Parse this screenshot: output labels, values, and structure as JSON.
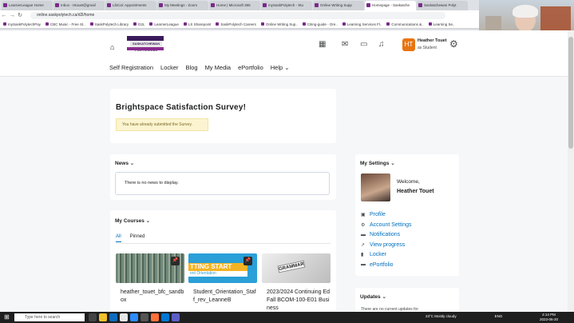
{
  "browser": {
    "tabs": [
      {
        "label": "LearnerLeague Home",
        "active": false
      },
      {
        "label": "Inbox - Htouet@gmail",
        "active": false
      },
      {
        "label": "LibCal: Appointments",
        "active": false
      },
      {
        "label": "My Meetings - Zoom",
        "active": false
      },
      {
        "label": "Home | Microsoft 365",
        "active": false
      },
      {
        "label": "mySaskPolytech - Stu",
        "active": false
      },
      {
        "label": "Online Writing Supp",
        "active": false
      },
      {
        "label": "Homepage - Saskatche",
        "active": true
      },
      {
        "label": "Saskatchewan Polyt",
        "active": false
      }
    ],
    "url": "online.saskpolytech.ca/d2l/home",
    "bookmarks": [
      "mySaskPolytechPay",
      "CBC Music - Free St..",
      "SaskPolytech Library",
      "D2L",
      "LearnerLeague",
      "LS Sharepoint",
      "SaskPolytech Careers",
      "Online Writing Sup..",
      "Citing-guide - Ore..",
      "Learning Services Fl..",
      "Communications &..",
      "Learning Se.."
    ]
  },
  "header": {
    "logo_text": "SASKATCHEWAN POLYTECHNIC",
    "user_initials": "HT",
    "user_name": "Heather Touet",
    "user_role": "as Student"
  },
  "nav": {
    "items": [
      "Self Registration",
      "Locker",
      "Blog",
      "My Media",
      "ePortfolio",
      "Help"
    ]
  },
  "survey": {
    "title": "Brightspace Satisfaction Survey!",
    "alert": "You have already submitted the Survey."
  },
  "news": {
    "title": "News",
    "empty": "There is no news to display."
  },
  "courses": {
    "title": "My Courses",
    "tabs": [
      "All",
      "Pinned"
    ],
    "tiles": [
      {
        "name": "heather_touet_bfc_sandbox",
        "img_text": ""
      },
      {
        "name": "Student_Orientation_Staff_rev_LeanneB",
        "img_text": "TTING STAR\nent Orientation"
      },
      {
        "name": "2023/2024 Continuing Ed Fall BCOM-100-E01 Business",
        "img_text": "GRAMMAR"
      }
    ]
  },
  "settings": {
    "title": "My Settings",
    "welcome": "Welcome,",
    "name": "Heather Touet",
    "links": [
      {
        "label": "Profile",
        "icon": "id-card-icon",
        "glyph": "▣"
      },
      {
        "label": "Account Settings",
        "icon": "gear-icon",
        "glyph": "⚙"
      },
      {
        "label": "Notifications",
        "icon": "chat-icon",
        "glyph": "▬"
      },
      {
        "label": "View progress",
        "icon": "chart-icon",
        "glyph": "↗"
      },
      {
        "label": "Locker",
        "icon": "locker-icon",
        "glyph": "▮"
      },
      {
        "label": "ePortfolio",
        "icon": "briefcase-icon",
        "glyph": "▬"
      }
    ]
  },
  "updates": {
    "title": "Updates",
    "text": "There are no current updates for"
  },
  "taskbar": {
    "search_placeholder": "Type here to search",
    "weather": "23°C  Mostly cloudy",
    "lang": "ENG",
    "time": "4:14 PM",
    "date": "2023-06-20"
  },
  "colors": {
    "accent_link": "#006fbf",
    "user_orange": "#e87511",
    "alert_bg": "#fcf4d0",
    "brand_purple": "#3b1a5a"
  }
}
